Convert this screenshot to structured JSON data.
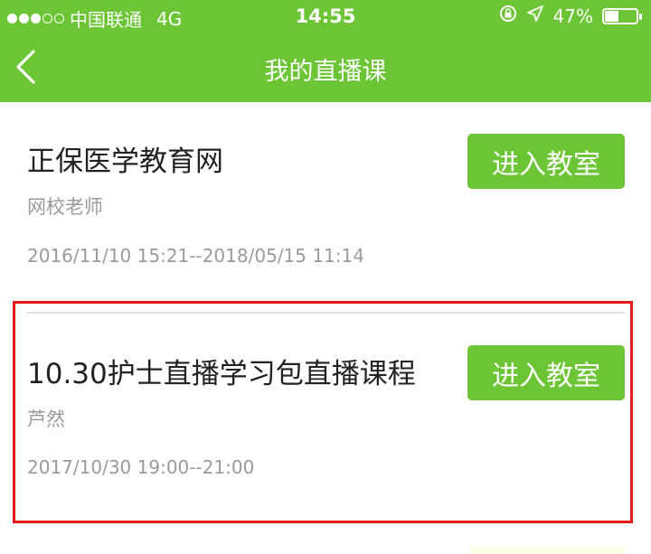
{
  "status_bar": {
    "carrier": "中国联通",
    "network": "4G",
    "time": "14:55",
    "battery": "47%",
    "battery_level": 0.47,
    "signal_bars": 3,
    "signal_total": 5
  },
  "nav": {
    "title": "我的直播课"
  },
  "courses": [
    {
      "name": "正保医学教育网",
      "teacher": "网校老师",
      "period": "2016/11/10 15:21--2018/05/15 11:14",
      "button_label": "进入教室"
    },
    {
      "name": "10.30护士直播学习包直播课程",
      "teacher": "芦然",
      "period": "2017/10/30 19:00--21:00",
      "button_label": "进入教室"
    }
  ],
  "colors": {
    "brand_green": "#6cc534",
    "highlight_red": "#e41b1b"
  }
}
